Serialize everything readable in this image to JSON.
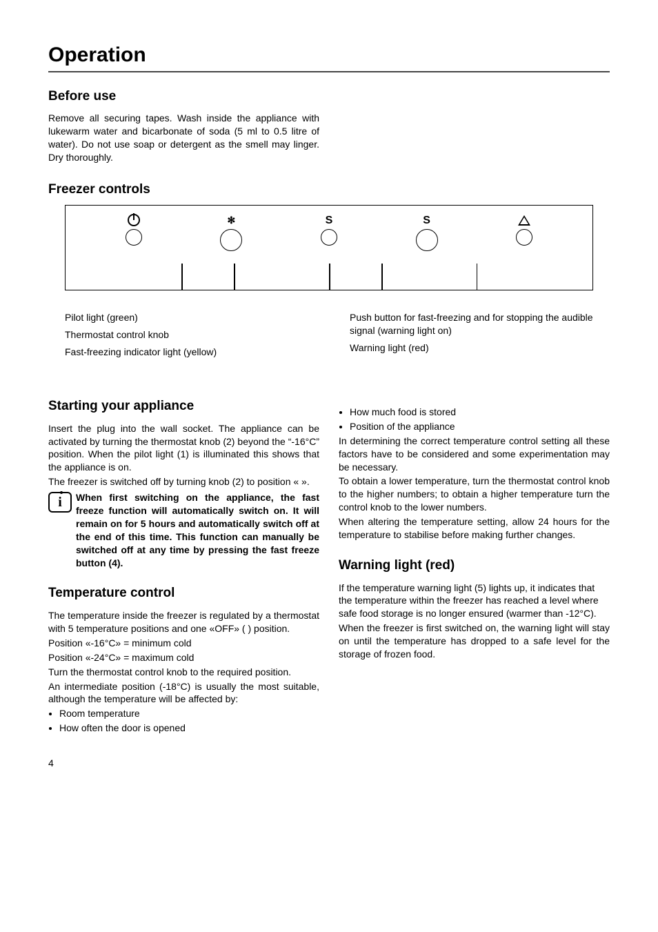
{
  "title": "Operation",
  "before_use": {
    "heading": "Before use",
    "body": "Remove all securing tapes. Wash inside the appliance with lukewarm water and bicarbonate of soda (5 ml to 0.5 litre of water). Do not use soap or detergent as the smell may linger. Dry thoroughly."
  },
  "freezer_controls": {
    "heading": "Freezer controls",
    "legend_left": {
      "l1": "Pilot light (green)",
      "l2": "Thermostat control knob",
      "l3": "Fast-freezing indicator light (yellow)"
    },
    "legend_right": {
      "l1": "Push button for fast-freezing and for stopping the audible signal (warning light on)",
      "l2": "Warning light (red)"
    }
  },
  "starting": {
    "heading": "Starting your appliance",
    "p1": "Insert the plug into the wall socket. The appliance can be activated by turning the thermostat knob (2) beyond the “-16°C” position. When the pilot light (1) is illuminated this shows that the appliance is on.",
    "p2": "The freezer is switched off by turning knob (2) to position «  ».",
    "info": "When first switching on the appliance, the fast freeze function will automatically switch on. It will remain on for 5 hours and automatically switch off at the end of this time. This function can manually be switched off at any time by pressing the fast freeze button (4)."
  },
  "temperature": {
    "heading": "Temperature control",
    "p1": "The temperature inside the freezer is regulated by a thermostat with 5 temperature positions and one «OFF» (  ) position.",
    "p2": "Position «-16°C» = minimum cold",
    "p3": "Position «-24°C» = maximum cold",
    "p4": "Turn the thermostat control knob to the required position.",
    "p5": "An intermediate position (-18°C) is usually the most suitable, although the temperature will be affected by:",
    "b1": "Room temperature",
    "b2": "How often the door is opened",
    "b3": "How much food is stored",
    "b4": "Position of the appliance",
    "p6": "In determining the correct temperature control setting all these factors have to be considered and some experimentation may be necessary.",
    "p7": "To obtain a lower temperature, turn the thermostat control knob to the higher numbers; to obtain a higher temperature turn the control knob to the lower numbers.",
    "p8": "When altering the temperature setting, allow 24 hours for the temperature to stabilise before making further changes."
  },
  "warning": {
    "heading": "Warning light (red)",
    "p1": "If the temperature warning light (5) lights up, it indicates that the temperature within the freezer has reached a level where safe food storage is no longer ensured (warmer than -12°C).",
    "p2": "When the freezer is first switched on, the warning light will stay on until the temperature has dropped to a safe level for the storage of frozen food."
  },
  "page_number": "4"
}
